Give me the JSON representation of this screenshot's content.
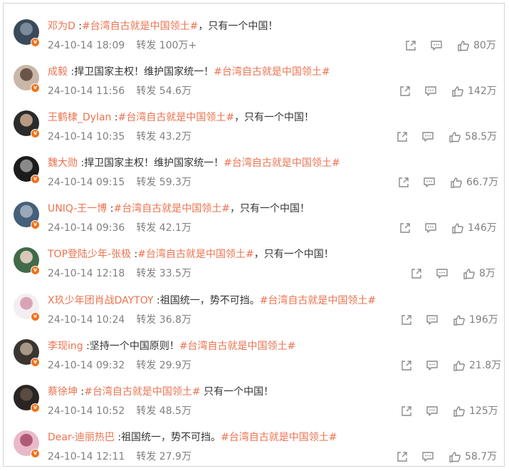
{
  "comments": [
    {
      "user": "邓为D",
      "sep": " :",
      "parts": [
        {
          "t": "#台湾自古就是中国领土#",
          "topic": true
        },
        {
          "t": "，只有一个中国！",
          "topic": false
        }
      ],
      "time": "24-10-14 18:09",
      "repost_label": "转发",
      "repost": "100万+",
      "likes": "80万",
      "avatar_colors": [
        "#3a4a5a",
        "#7a8a9a"
      ]
    },
    {
      "user": "成毅",
      "sep": " :",
      "parts": [
        {
          "t": "捍卫国家主权！维护国家统一！",
          "topic": false
        },
        {
          "t": "#台湾自古就是中国领土#",
          "topic": true
        }
      ],
      "time": "24-10-14 11:56",
      "repost_label": "转发",
      "repost": "54.6万",
      "likes": "142万",
      "avatar_colors": [
        "#c9b7a8",
        "#6b5548"
      ]
    },
    {
      "user": "王鹤棣_Dylan",
      "sep": " :",
      "parts": [
        {
          "t": "#台湾自古就是中国领土#",
          "topic": true
        },
        {
          "t": "，只有一个中国！",
          "topic": false
        }
      ],
      "time": "24-10-14 10:35",
      "repost_label": "转发",
      "repost": "43.2万",
      "likes": "58.5万",
      "avatar_colors": [
        "#2b2b2b",
        "#b89a82"
      ]
    },
    {
      "user": "魏大勋",
      "sep": " :",
      "parts": [
        {
          "t": "捍卫国家主权！维护国家统一！",
          "topic": false
        },
        {
          "t": "#台湾自古就是中国领土#",
          "topic": true
        }
      ],
      "time": "24-10-14 09:15",
      "repost_label": "转发",
      "repost": "59.3万",
      "likes": "66.7万",
      "avatar_colors": [
        "#1c1c1c",
        "#8a8a8a"
      ]
    },
    {
      "user": "UNIQ-王一博",
      "sep": " :",
      "parts": [
        {
          "t": "#台湾自古就是中国领土#",
          "topic": true
        },
        {
          "t": "，只有一个中国！",
          "topic": false
        }
      ],
      "time": "24-10-14 09:36",
      "repost_label": "转发",
      "repost": "42.1万",
      "likes": "146万",
      "avatar_colors": [
        "#45607a",
        "#9aa8b8"
      ]
    },
    {
      "user": "TOP登陆少年-张极",
      "sep": " :",
      "parts": [
        {
          "t": "#台湾自古就是中国领土#",
          "topic": true
        },
        {
          "t": "，只有一个中国！",
          "topic": false
        }
      ],
      "time": "24-10-14 12:18",
      "repost_label": "转发",
      "repost": "33.5万",
      "likes": "8万",
      "avatar_colors": [
        "#3f6b4a",
        "#d8c8b8"
      ]
    },
    {
      "user": "X玖少年团肖战DAYTOY",
      "sep": " :",
      "parts": [
        {
          "t": "祖国统一，势不可挡。",
          "topic": false
        },
        {
          "t": "#台湾自古就是中国领土#",
          "topic": true
        }
      ],
      "time": "24-10-14 10:24",
      "repost_label": "转发",
      "repost": "36.8万",
      "likes": "196万",
      "avatar_colors": [
        "#f3eef2",
        "#d9a3b5"
      ]
    },
    {
      "user": "李现ing",
      "sep": " :",
      "parts": [
        {
          "t": "坚持一个中国原则！",
          "topic": false
        },
        {
          "t": "#台湾自古就是中国领土#",
          "topic": true
        }
      ],
      "time": "24-10-14 09:32",
      "repost_label": "转发",
      "repost": "29.9万",
      "likes": "21.8万",
      "avatar_colors": [
        "#3a3530",
        "#a89888"
      ]
    },
    {
      "user": "蔡徐坤",
      "sep": " :",
      "parts": [
        {
          "t": "#台湾自古就是中国领土#",
          "topic": true
        },
        {
          "t": " 只有一个中国！",
          "topic": false
        }
      ],
      "time": "24-10-14 10:52",
      "repost_label": "转发",
      "repost": "48.5万",
      "likes": "125万",
      "avatar_colors": [
        "#2a2522",
        "#5a4a40"
      ]
    },
    {
      "user": "Dear-迪丽热巴",
      "sep": " :",
      "parts": [
        {
          "t": "祖国统一，势不可挡。",
          "topic": false
        },
        {
          "t": "#台湾自古就是中国领土#",
          "topic": true
        }
      ],
      "time": "24-10-14 12:11",
      "repost_label": "转发",
      "repost": "27.9万",
      "likes": "58.7万",
      "avatar_colors": [
        "#e8b9c8",
        "#b05a78"
      ]
    }
  ]
}
